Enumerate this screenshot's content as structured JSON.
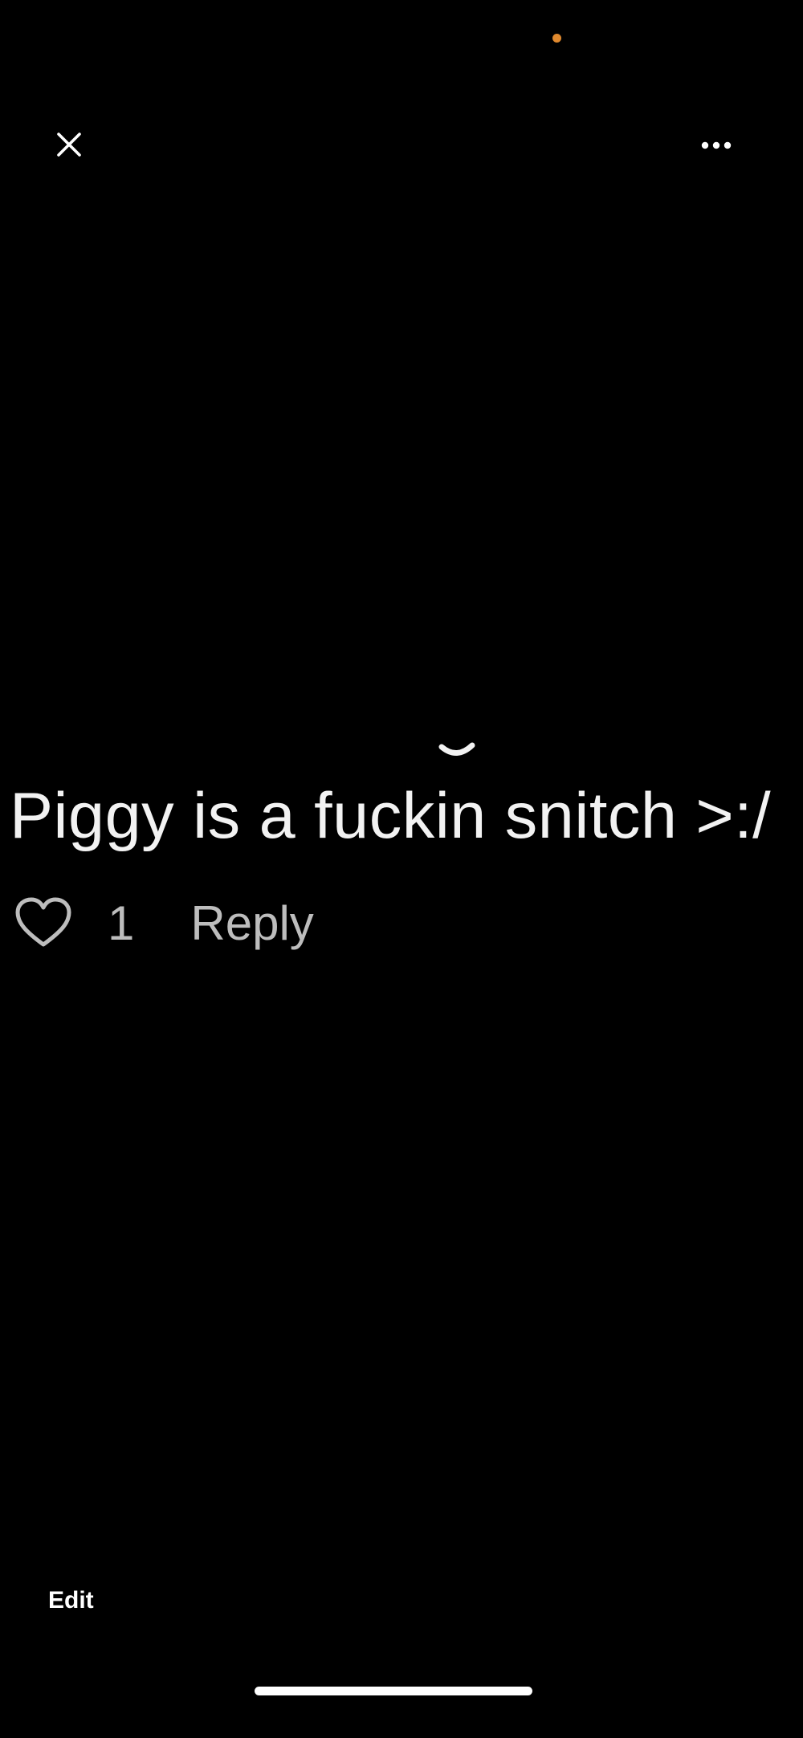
{
  "status": {
    "privacy_indicator_color": "#e0892e"
  },
  "toolbar": {
    "close_icon": "close-icon",
    "more_icon": "more-horizontal-icon"
  },
  "photo": {
    "comment_text": "Piggy is a fuckin snitch >:/",
    "like_icon": "heart-outline-icon",
    "like_count": "1",
    "reply_label": "Reply"
  },
  "bottom_bar": {
    "edit_label": "Edit"
  }
}
